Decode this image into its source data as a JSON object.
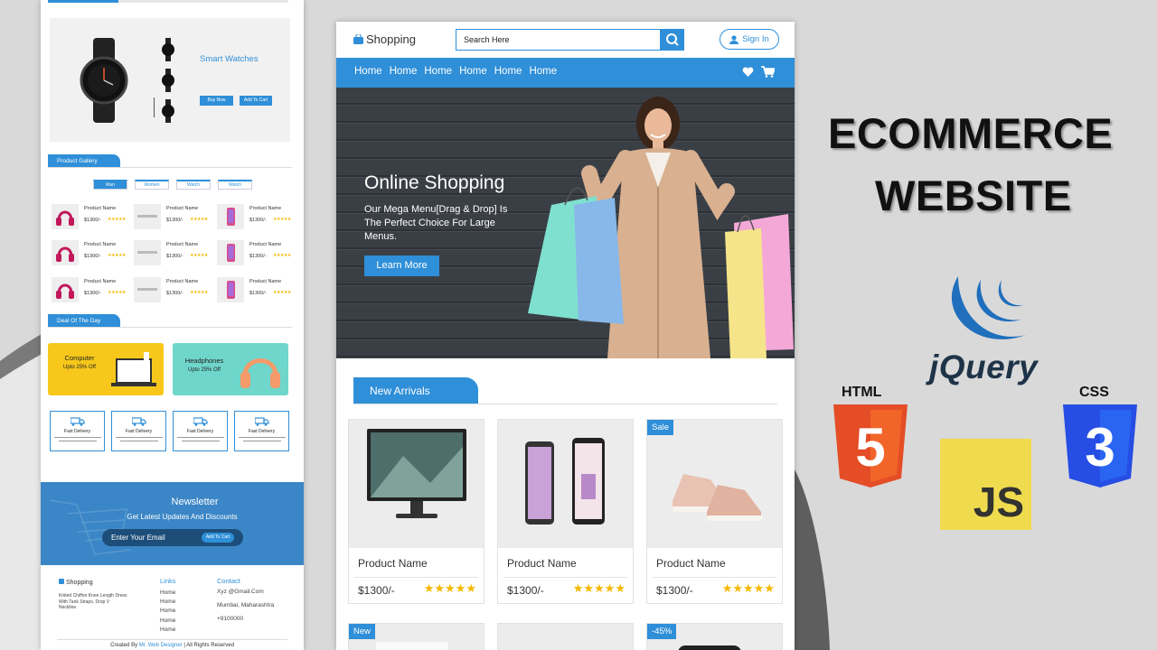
{
  "headline": {
    "line1": "ECOMMERCE",
    "line2": "WEBSITE"
  },
  "tech_logos": {
    "html": "HTML",
    "html_digit": "5",
    "css": "CSS",
    "css_digit": "3",
    "jquery": "jQuery",
    "js": "JS"
  },
  "left_mockup": {
    "hero": {
      "title": "Smart Watches",
      "buy_button": "Buy Now",
      "cart_button": "Add To Cart"
    },
    "gallery": {
      "section_title": "Product Gallery",
      "tabs": [
        "Man",
        "Women",
        "Watch",
        "Watch"
      ],
      "item_name": "Product Name",
      "item_price": "$1300/-",
      "item_stars": "★★★★★"
    },
    "deals": {
      "section_title": "Deal Of The Day",
      "cards": [
        {
          "title": "Computer",
          "subtitle": "Upto 25% Off"
        },
        {
          "title": "Headphones",
          "subtitle": "Upto 25% Off"
        }
      ]
    },
    "features": {
      "title": "Fast Delivery"
    },
    "newsletter": {
      "title": "Newsletter",
      "subtitle": "Get Latest Updates And Discounts",
      "input_placeholder": "Enter Your Email",
      "button": "Add To Cart"
    },
    "footer": {
      "logo": "Shopping",
      "description": "Knited Chiffon Knee Length Dress With Tank Straps, Drop V Neckline",
      "links_title": "Links",
      "links": [
        "Home",
        "Home",
        "Home",
        "Home",
        "Home"
      ],
      "contact_title": "Contact",
      "contact": [
        "Xyz @Gmail.Com",
        "Mumbai, Maharashtra",
        "+9100000"
      ],
      "credit_prefix": "Created By",
      "credit_name": "Mr. Web Designer",
      "credit_suffix": "| All Rights Reserved"
    }
  },
  "main_mockup": {
    "header": {
      "logo": "Shopping",
      "search_placeholder": "Search Here",
      "signin": "Sign In"
    },
    "nav": {
      "items": [
        "Home",
        "Home",
        "Home",
        "Home",
        "Home",
        "Home"
      ]
    },
    "hero": {
      "title": "Online Shopping",
      "description": "Our Mega Menu[Drag & Drop] Is The Perfect Choice For Large Menus.",
      "button": "Learn More"
    },
    "arrivals": {
      "section_title": "New Arrivals",
      "cards": [
        {
          "name": "Product Name",
          "price": "$1300/-",
          "stars": "★★★★★",
          "badge": "",
          "image": "monitor"
        },
        {
          "name": "Product Name",
          "price": "$1300/-",
          "stars": "★★★★★",
          "badge": "",
          "image": "phones"
        },
        {
          "name": "Product Name",
          "price": "$1300/-",
          "stars": "★★★★★",
          "badge": "Sale",
          "image": "sneakers"
        }
      ],
      "next_row_badges": [
        "New",
        "",
        "-45%"
      ]
    }
  },
  "colors": {
    "accent": "#2f8fd8",
    "star": "#f5b800",
    "background": "#d9d9d9"
  }
}
